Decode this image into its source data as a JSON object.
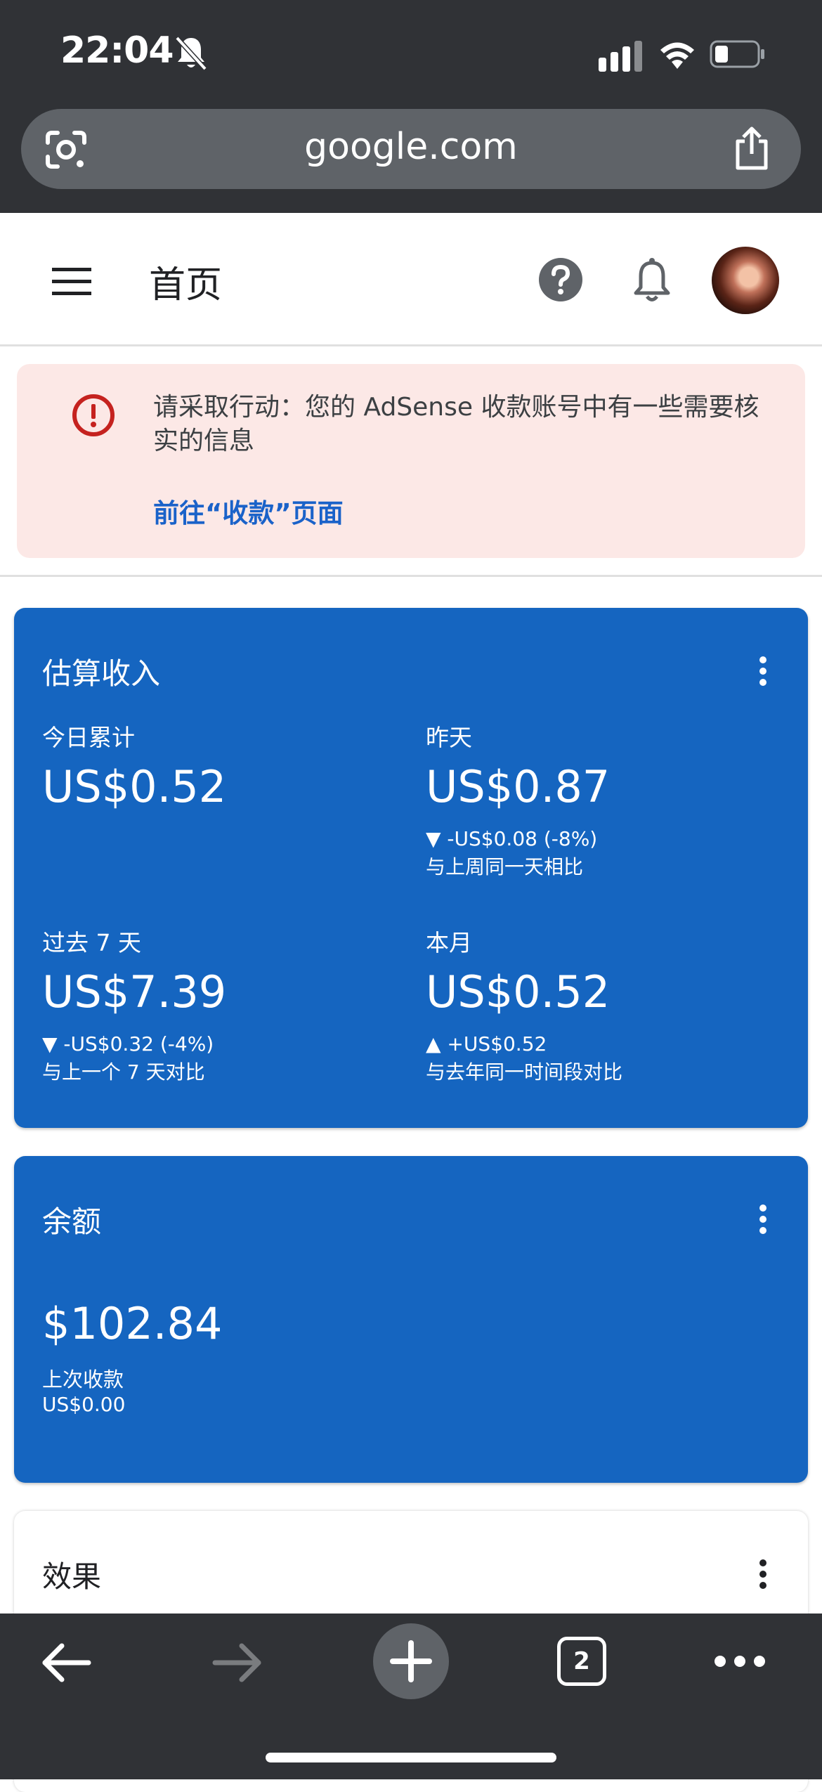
{
  "status_bar": {
    "time": "22:04"
  },
  "browser": {
    "url": "google.com",
    "open_tabs": "2"
  },
  "header": {
    "title": "首页"
  },
  "alert": {
    "message": "请采取行动：您的 AdSense 收款账号中有一些需要核实的信息",
    "link": "前往“收款”页面"
  },
  "earnings": {
    "title": "估算收入",
    "today": {
      "label": "今日累计",
      "value": "US$0.52"
    },
    "yesterday": {
      "label": "昨天",
      "value": "US$0.87",
      "delta": "▼ -US$0.08 (-8%)",
      "compare": "与上周同一天相比"
    },
    "last7": {
      "label": "过去 7 天",
      "value": "US$7.39",
      "delta": "▼ -US$0.32 (-4%)",
      "compare": "与上一个 7 天对比"
    },
    "month": {
      "label": "本月",
      "value": "US$0.52",
      "delta": "▲ +US$0.52",
      "compare": "与去年同一时间段对比"
    }
  },
  "balance": {
    "title": "余额",
    "value": "$102.84",
    "last_payment_label": "上次收款",
    "last_payment_value": "US$0.00"
  },
  "performance": {
    "title": "效果"
  },
  "colors": {
    "primary_blue": "#1565c0",
    "alert_bg": "#fce8e6",
    "alert_red": "#c5221f",
    "link_blue": "#1a62c9",
    "chrome_dark": "#303236"
  }
}
